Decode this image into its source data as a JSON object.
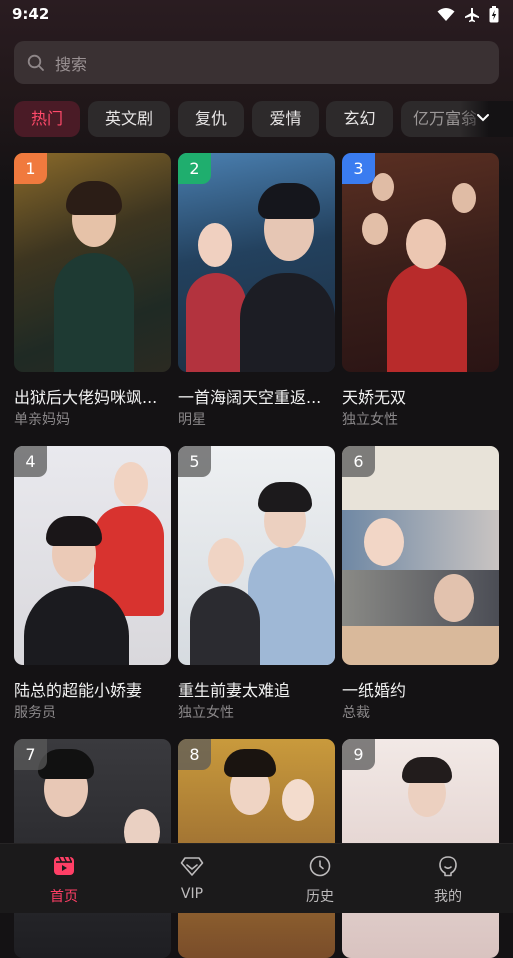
{
  "status": {
    "time": "9:42",
    "icons": [
      "wifi-icon",
      "airplane-icon",
      "battery-icon"
    ]
  },
  "search": {
    "placeholder": "搜索",
    "icon": "search-icon"
  },
  "categories": [
    {
      "label": "热门",
      "active": true
    },
    {
      "label": "英文剧"
    },
    {
      "label": "复仇"
    },
    {
      "label": "爱情"
    },
    {
      "label": "玄幻"
    },
    {
      "label": "亿万富翁"
    }
  ],
  "more_icon": "chevron-down-icon",
  "dramas": [
    {
      "rank": "1",
      "title": "出狱后大佬妈咪飒...",
      "tag": "单亲妈妈",
      "rank_color": "#f07a3e"
    },
    {
      "rank": "2",
      "title": "一首海阔天空重返...",
      "tag": "明星",
      "rank_color": "#1fae6e"
    },
    {
      "rank": "3",
      "title": "天娇无双",
      "tag": "独立女性",
      "rank_color": "#3a7cf0"
    },
    {
      "rank": "4",
      "title": "陆总的超能小娇妻",
      "tag": "服务员"
    },
    {
      "rank": "5",
      "title": "重生前妻太难追",
      "tag": "独立女性"
    },
    {
      "rank": "6",
      "title": "一纸婚约",
      "tag": "总裁"
    },
    {
      "rank": "7",
      "title": "",
      "tag": ""
    },
    {
      "rank": "8",
      "title": "",
      "tag": ""
    },
    {
      "rank": "9",
      "title": "",
      "tag": ""
    }
  ],
  "tabs": [
    {
      "label": "首页",
      "icon": "clapperboard-icon",
      "active": true
    },
    {
      "label": "VIP",
      "icon": "diamond-icon"
    },
    {
      "label": "历史",
      "icon": "clock-icon"
    },
    {
      "label": "我的",
      "icon": "profile-icon"
    }
  ],
  "colors": {
    "accent": "#ff3f66",
    "background": "#141214",
    "chip": "#2d2a2b",
    "chip_active_bg": "#4a1b26"
  }
}
